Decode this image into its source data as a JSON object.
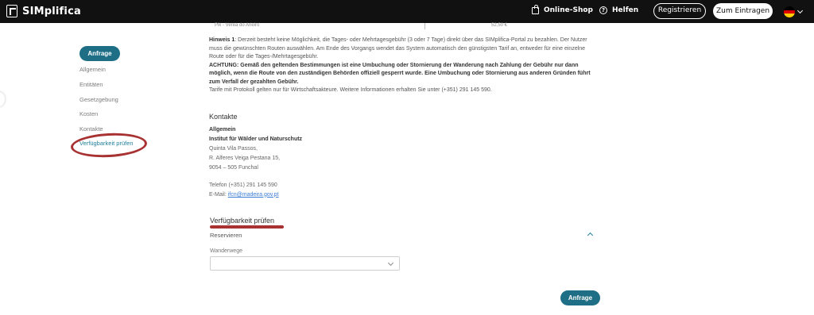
{
  "header": {
    "logo_text": "SIMplifica",
    "shop_label": "Online-Shop",
    "help_label": "Helfen",
    "register_label": "Registrieren",
    "login_label": "Zum Eintragen",
    "flag_colors": [
      "#000000",
      "#dd0000",
      "#ffce00"
    ]
  },
  "sidebar": {
    "request_label": "Anfrage",
    "items": [
      {
        "label": "Allgemein"
      },
      {
        "label": "Entitäten"
      },
      {
        "label": "Gesetzgebung"
      },
      {
        "label": "Kosten"
      },
      {
        "label": "Kontakte"
      },
      {
        "label": "Verfügbarkeit prüfen"
      }
    ]
  },
  "faded_row": {
    "left": "Pik - Verea do Arieiro",
    "right": "52,50 €"
  },
  "notes": {
    "hint_label": "Hinweis 1",
    "hint_text": ": Derzeit besteht keine Möglichkeit, die Tages- oder Mehrtagesgebühr (3 oder 7 Tage) direkt über das SIMplifica-Portal zu bezahlen. Der Nutzer muss die gewünschten Routen auswählen. Am Ende des Vorgangs wendet das System automatisch den günstigsten Tarif an, entweder für eine einzelne Route oder für die Tages-/Mehrtagesgebühr.",
    "warning_label": "ACHTUNG",
    "warning_text": ": Gemäß den geltenden Bestimmungen ist eine Umbuchung oder Stornierung der Wanderung nach Zahlung der Gebühr nur dann möglich, wenn die Route von den zuständigen Behörden offiziell gesperrt wurde. Eine Umbuchung oder Stornierung aus anderen Gründen führt zum Verfall der gezahlten Gebühr.",
    "tariff_text": "Tarife mit Protokoll gelten nur für Wirtschaftsakteure. Weitere Informationen erhalten Sie unter (+351) 291 145 590."
  },
  "contacts": {
    "title": "Kontakte",
    "group": "Allgemein",
    "org": "Institut für Wälder und Naturschutz",
    "address1": "Quinta Vila Passos,",
    "address2": "R. Alferes Veiga Pestana 15,",
    "address3": "9054 – 505 Funchal",
    "phone": "Telefon (+351) 291 145 590",
    "email_label": "E-Mail:",
    "email": "ifcn@madeira.gov.pt"
  },
  "availability": {
    "title": "Verfügbarkeit prüfen",
    "reserve_label": "Reservieren",
    "field_label": "Wanderwege",
    "select_value": "",
    "request_label": "Anfrage"
  }
}
